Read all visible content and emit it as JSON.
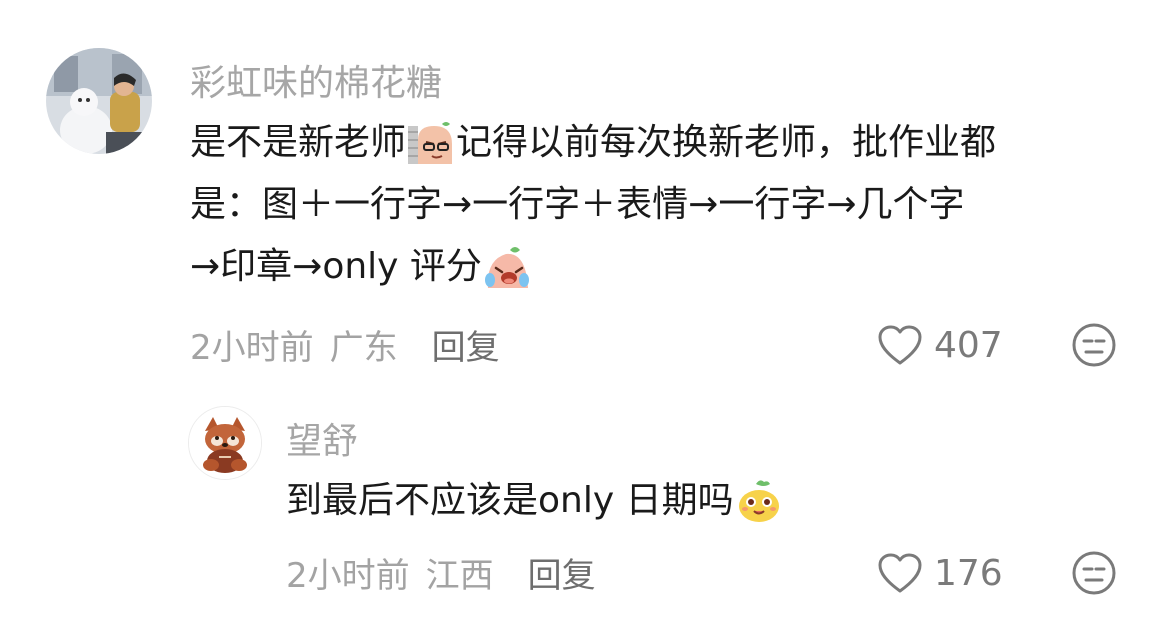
{
  "comments": [
    {
      "username": "彩虹味的棉花糖",
      "text_lines": [
        [
          "是不是新老师",
          "记得以前每次换新老师，批作业都"
        ],
        [
          "是：图＋一行字→一行字＋表情→一行字→几个字"
        ],
        [
          "→印章→only 评分"
        ]
      ],
      "time": "2小时前",
      "location": "广东",
      "reply_label": "回复",
      "likes": "407",
      "emojis": [
        "sly-face-emoji",
        "crying-laugh-emoji"
      ]
    },
    {
      "username": "望舒",
      "text_lines": [
        [
          "到最后不应该是only 日期吗"
        ]
      ],
      "time": "2小时前",
      "location": "江西",
      "reply_label": "回复",
      "likes": "176",
      "emojis": [
        "yellow-bean-emoji"
      ]
    }
  ],
  "icons": {
    "like": "heart-outline-icon",
    "dislike": "meh-face-icon"
  },
  "colors": {
    "username": "#a6a6a6",
    "meta": "#a3a3a3",
    "text": "#1a1a1a"
  }
}
